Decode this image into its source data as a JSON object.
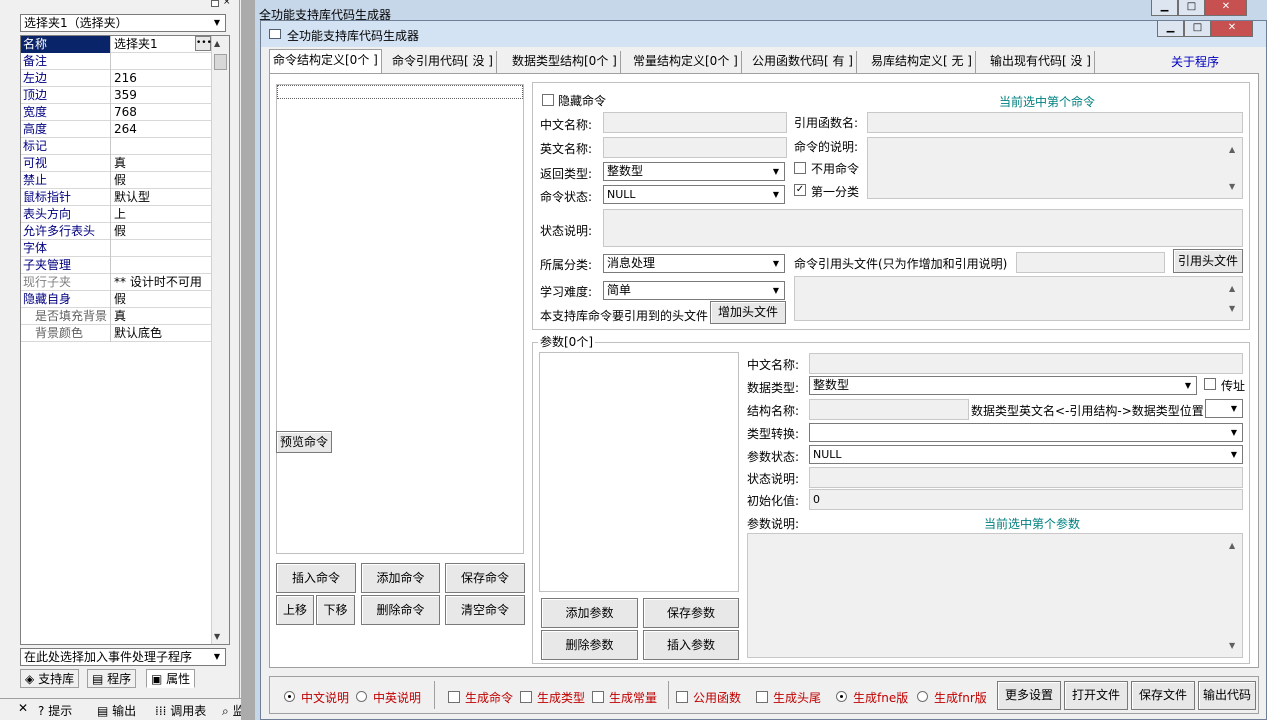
{
  "left_panel": {
    "object_select": "选择夹1（选择夹）",
    "properties": [
      {
        "name": "名称",
        "value": "选择夹1"
      },
      {
        "name": "备注",
        "value": ""
      },
      {
        "name": "左边",
        "value": "216"
      },
      {
        "name": "顶边",
        "value": "359"
      },
      {
        "name": "宽度",
        "value": "768"
      },
      {
        "name": "高度",
        "value": "264"
      },
      {
        "name": "标记",
        "value": ""
      },
      {
        "name": "可视",
        "value": "真"
      },
      {
        "name": "禁止",
        "value": "假"
      },
      {
        "name": "鼠标指针",
        "value": "默认型"
      },
      {
        "name": "表头方向",
        "value": "上"
      },
      {
        "name": "允许多行表头",
        "value": "假"
      },
      {
        "name": "字体",
        "value": ""
      },
      {
        "name": "子夹管理",
        "value": ""
      },
      {
        "name": "现行子夹",
        "value": "** 设计时不可用"
      },
      {
        "name": "隐藏自身",
        "value": "假"
      },
      {
        "name": "是否填充背景",
        "value": "真"
      },
      {
        "name": "背景颜色",
        "value": "默认底色"
      }
    ],
    "event_select": "在此处选择加入事件处理子程序",
    "tabs": [
      "支持库",
      "程序",
      "属性"
    ],
    "bottom_tabs": [
      "提示",
      "输出",
      "调用表",
      "监"
    ]
  },
  "background_window": {
    "title": "全功能支持库代码生成器"
  },
  "window": {
    "title": "全功能支持库代码生成器",
    "tabs": [
      "命令结构定义[0个 ]",
      "命令引用代码[ 没 ]",
      "数据类型结构[0个 ]",
      "常量结构定义[0个 ]",
      "公用函数代码[ 有 ]",
      "易库结构定义[ 无 ]",
      "输出现有代码[ 没 ]"
    ],
    "about_link": "关于程序"
  },
  "command_panel": {
    "preview_button": "预览命令",
    "buttons": [
      "插入命令",
      "添加命令",
      "保存命令",
      "上移",
      "下移",
      "删除命令",
      "清空命令"
    ]
  },
  "command_form": {
    "hide_command_label": "隐藏命令",
    "current_command_label": "当前选中第个命令",
    "cn_name_label": "中文名称:",
    "ref_func_label": "引用函数名:",
    "en_name_label": "英文名称:",
    "cmd_desc_label": "命令的说明:",
    "return_type_label": "返回类型:",
    "return_type_value": "整数型",
    "disable_cmd_label": "不用命令",
    "cmd_state_label": "命令状态:",
    "cmd_state_value": "NULL",
    "first_category_label": "第一分类",
    "state_desc_label": "状态说明:",
    "category_label": "所属分类:",
    "category_value": "消息处理",
    "header_ref_label": "命令引用头文件(只为作增加和引用说明)",
    "ref_header_button": "引用头文件",
    "difficulty_label": "学习难度:",
    "difficulty_value": "简单",
    "lib_header_label": "本支持库命令要引用到的头文件",
    "add_header_button": "增加头文件"
  },
  "param_form": {
    "group_label": "参数[0个]",
    "cn_name_label": "中文名称:",
    "data_type_label": "数据类型:",
    "data_type_value": "整数型",
    "byref_label": "传址",
    "struct_name_label": "结构名称:",
    "struct_hint_label": "数据类型英文名<-引用结构->数据类型位置",
    "type_convert_label": "类型转换:",
    "param_state_label": "参数状态:",
    "param_state_value": "NULL",
    "state_desc_label": "状态说明:",
    "init_label": "初始化值:",
    "init_value": "0",
    "param_desc_label": "参数说明:",
    "current_param_label": "当前选中第个参数",
    "buttons": [
      "添加参数",
      "保存参数",
      "删除参数",
      "插入参数"
    ]
  },
  "bottom_bar": {
    "radio_cn": "中文说明",
    "radio_cnen": "中英说明",
    "gen_cmd": "生成命令",
    "gen_type": "生成类型",
    "gen_const": "生成常量",
    "public_func": "公用函数",
    "gen_header": "生成头尾",
    "gen_fne": "生成fne版",
    "gen_fnr": "生成fnr版",
    "buttons": [
      "更多设置",
      "打开文件",
      "保存文件",
      "输出代码"
    ]
  }
}
